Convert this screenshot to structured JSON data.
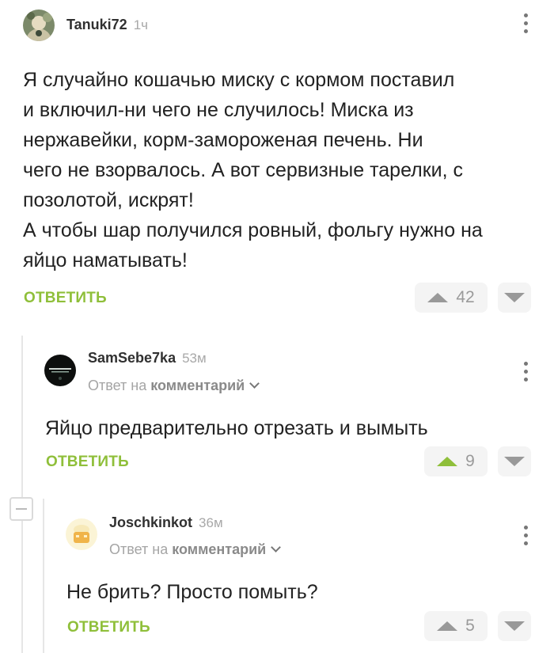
{
  "comments": [
    {
      "username": "Tanuki72",
      "time": "1ч",
      "text": "Я случайно кошачью миску с кормом поставил\nи включил-ни чего не случилось! Миска из\nнержавейки, корм-замороженая печень. Ни\nчего не взорвалось. А вот сервизные тарелки, с\nпозолотой, искрят!\nА чтобы шар получился ровный, фольгу нужно на\nяйцо наматывать!",
      "reply_label": "ОТВЕТИТЬ",
      "votes": "42"
    },
    {
      "username": "SamSebe7ka",
      "time": "53м",
      "reply_to_prefix": "Ответ на",
      "reply_to_target": "комментарий",
      "text": "Яйцо предварительно отрезать и вымыть",
      "reply_label": "ОТВЕТИТЬ",
      "votes": "9"
    },
    {
      "username": "Joschkinkot",
      "time": "36м",
      "reply_to_prefix": "Ответ на",
      "reply_to_target": "комментарий",
      "text": "Не брить? Просто помыть?",
      "reply_label": "ОТВЕТИТЬ",
      "votes": "5"
    }
  ],
  "colors": {
    "accent_green": "#8fbf3a",
    "thread_line": "#e6e6e6",
    "vote_bg": "#f4f4f4"
  },
  "icons": {
    "more": "vertical-dots-icon",
    "upvote": "triangle-up-icon",
    "downvote": "triangle-down-icon",
    "collapse": "minus-icon",
    "chevron": "chevron-down-icon"
  }
}
